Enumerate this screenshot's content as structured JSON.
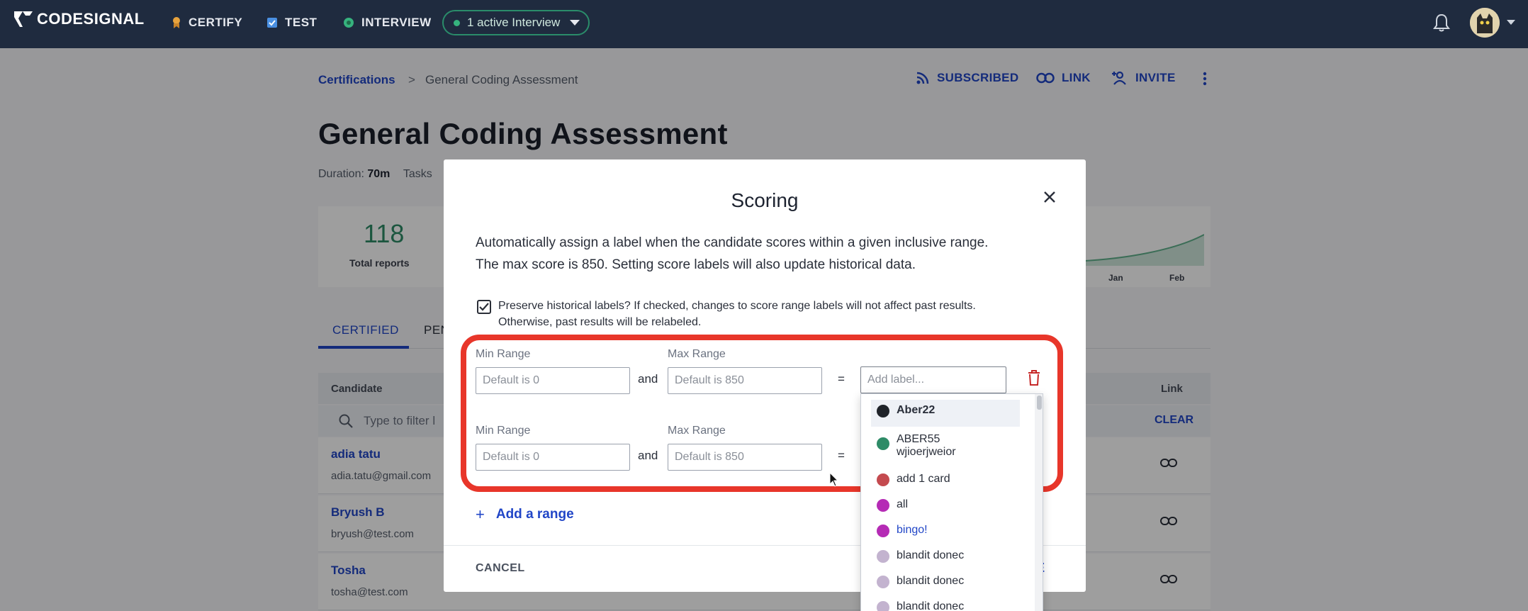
{
  "topnav": {
    "logo_text": "CODESIGNAL",
    "items": [
      {
        "label": "CERTIFY",
        "icon": "certify-icon",
        "color": "#e8a33d"
      },
      {
        "label": "TEST",
        "icon": "test-icon",
        "color": "#4a90e2"
      },
      {
        "label": "INTERVIEW",
        "icon": "interview-icon",
        "color": "#36b37e"
      }
    ],
    "interview_pill": "1 active Interview"
  },
  "breadcrumb": {
    "root": "Certifications",
    "separator": ">",
    "current": "General Coding Assessment"
  },
  "header_actions": {
    "subscribed": "SUBSCRIBED",
    "link": "LINK",
    "invite": "INVITE"
  },
  "page": {
    "title": "General Coding Assessment",
    "duration_label": "Duration:",
    "duration_value": "70m",
    "tasks_label": "Tasks"
  },
  "stats": {
    "total_reports": "118",
    "total_reports_label": "Total reports",
    "months": [
      "Jan",
      "Feb"
    ]
  },
  "tabs": [
    "CERTIFIED",
    "PEN"
  ],
  "table": {
    "col_candidate": "Candidate",
    "col_link": "Link",
    "filter_placeholder": "Type to filter l",
    "clear": "CLEAR",
    "rows": [
      {
        "name": "adia tatu",
        "email": "adia.tatu@gmail.com"
      },
      {
        "name": "Bryush B",
        "email": "bryush@test.com"
      },
      {
        "name": "Tosha",
        "email": "tosha@test.com"
      }
    ]
  },
  "modal": {
    "title": "Scoring",
    "description_1": "Automatically assign a label when the candidate scores within a given inclusive range.",
    "description_2": "The max score is 850. Setting score labels will also update historical data.",
    "preserve_label_1": "Preserve historical labels? If checked, changes to score range labels will not affect past results.",
    "preserve_label_2": "Otherwise, past results will be relabeled.",
    "ranges": [
      {
        "min_label": "Min Range",
        "min_placeholder": "Default is 0",
        "and": "and",
        "max_label": "Max Range",
        "max_placeholder": "Default is 850",
        "eq": "=",
        "label_placeholder": "Add label..."
      },
      {
        "min_label": "Min Range",
        "min_placeholder": "Default is 0",
        "and": "and",
        "max_label": "Max Range",
        "max_placeholder": "Default is 850",
        "eq": "="
      }
    ],
    "add_range": "Add a range",
    "cancel": "CANCEL",
    "save_partial": "E"
  },
  "label_options": [
    {
      "label": "Aber22",
      "color": "#1f2329"
    },
    {
      "label": "ABER55",
      "label2": "wjioerjweior",
      "color": "#2e8b67"
    },
    {
      "label": "add 1 card",
      "color": "#c44a4f"
    },
    {
      "label": "all",
      "color": "#b52bb5"
    },
    {
      "label": "bingo!",
      "color": "#b52bb5"
    },
    {
      "label": "blandit donec",
      "color": "#c3b3cf"
    },
    {
      "label": "blandit donec",
      "color": "#c3b3cf"
    },
    {
      "label": "blandit donec",
      "color": "#c3b3cf"
    }
  ],
  "colors": {
    "nav_bg": "#1f2b3f",
    "accent": "#2146c7",
    "highlight": "#e8362a",
    "stat_green": "#2e8b67"
  }
}
